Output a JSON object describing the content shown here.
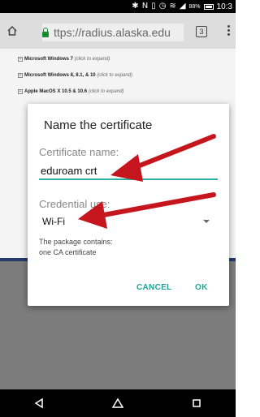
{
  "status_bar": {
    "battery": "88%",
    "time": "10:3"
  },
  "browser": {
    "url": "ttps://radius.alaska.edu",
    "tab_count": "3"
  },
  "page": {
    "items": [
      {
        "name": "Microsoft Windows 7",
        "note": "(click to expand)"
      },
      {
        "name": "Microsoft Windows 8, 8.1, & 10",
        "note": "(click to expand)"
      },
      {
        "name": "Apple MacOS X 10.5 & 10.6",
        "note": "(click to expand)"
      }
    ]
  },
  "dialog": {
    "title": "Name the certificate",
    "cert_label": "Certificate name:",
    "cert_value": "eduroam crt",
    "cred_label": "Credential use:",
    "cred_value": "Wi-Fi",
    "package_line1": "The package contains:",
    "package_line2": "one CA certificate",
    "cancel": "CANCEL",
    "ok": "OK"
  },
  "colors": {
    "accent": "#2bb3a4",
    "arrow": "#c4161c",
    "secure_lock": "#1a8c2f"
  },
  "icons": {
    "status": [
      "bluetooth-icon",
      "nfc-icon",
      "vibrate-icon",
      "alarm-icon",
      "wifi-icon",
      "signal-icon",
      "battery-icon"
    ],
    "nav": [
      "back-icon",
      "home-icon",
      "recents-icon"
    ]
  }
}
